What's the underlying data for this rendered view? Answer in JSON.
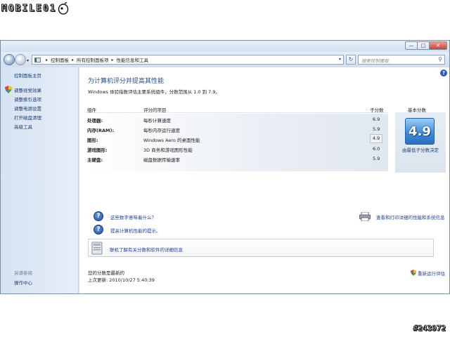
{
  "watermark": {
    "logo_text": "MOBILE01",
    "stamp": "#243972"
  },
  "titlebar": {
    "minimize": "—",
    "maximize": "□",
    "close": "✕"
  },
  "nav": {
    "back_icon": "back-arrow-icon",
    "forward_icon": "forward-arrow-icon",
    "breadcrumb": [
      "控制面板",
      "所有控制面板项",
      "性能信息和工具"
    ],
    "separator": "▸",
    "dropdown": "▾",
    "refresh_icon": "↻",
    "search_placeholder": "搜索控制面板"
  },
  "sidebar": {
    "home": "控制面板主页",
    "items": [
      "调整视觉效果",
      "调整索引选项",
      "调整电源设置",
      "打开磁盘清理",
      "高级工具"
    ],
    "see_also": "另请参阅",
    "see_also_items": [
      "操作中心"
    ]
  },
  "main": {
    "heading": "为计算机评分并提高其性能",
    "subtext": "Windows 体验指数评估主要系统组件，分数范围从 1.0 到 7.9。",
    "table": {
      "headers": {
        "component": "组件",
        "rated": "评分的项目",
        "subscore": "子分数",
        "base": "基本分数"
      },
      "rows": [
        {
          "component": "处理器:",
          "rated": "每秒计算速度",
          "subscore": "6.9"
        },
        {
          "component": "内存(RAM):",
          "rated": "每秒内存运行速度",
          "subscore": "5.9"
        },
        {
          "component": "图形:",
          "rated": "Windows Aero 的桌面性能",
          "subscore": "4.9"
        },
        {
          "component": "游戏图形:",
          "rated": "3D 商务和游戏图形性能",
          "subscore": "6.0"
        },
        {
          "component": "主硬盘:",
          "rated": "磁盘数据传输速率",
          "subscore": "5.9"
        }
      ],
      "base_score": "4.9",
      "base_caption": "由最低子分数决定"
    },
    "links": {
      "q1": "这些数字意味着什么？",
      "q2": "提高计算机性能的提示。",
      "print": "查看和打印详细的性能和系统信息",
      "online": "联机了解有关分数和软件的详细信息"
    },
    "status": {
      "line1": "您的分数是最新的",
      "line2": "上次更新: 2010/10/27 5:40:39",
      "rerun": "重新运行评估"
    }
  }
}
